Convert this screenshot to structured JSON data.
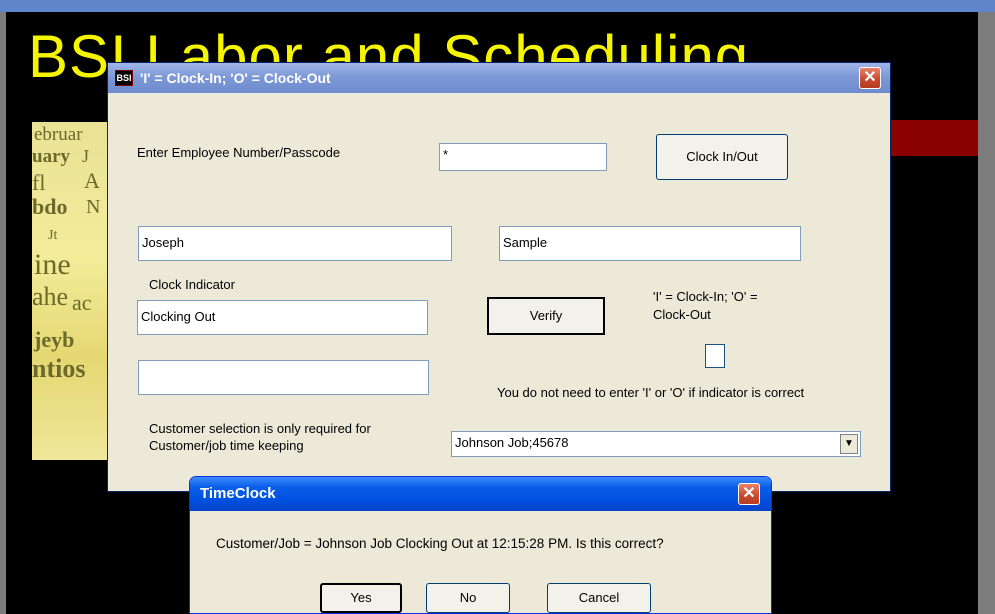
{
  "background": {
    "title": "BSI Labor and Scheduling",
    "calendar_text": [
      "ebruar",
      "uary",
      "J",
      "fl",
      "A",
      "bdo",
      "N",
      "Jt",
      "ine",
      "ahe",
      "ac",
      "jeyb",
      "ntios"
    ]
  },
  "main_dialog": {
    "icon_text": "BSI",
    "title": "'I' = Clock-In; 'O' = Clock-Out",
    "close_glyph": "✕",
    "employee_label": "Enter Employee Number/Passcode",
    "employee_value": "*",
    "clock_button": "Clock In/Out",
    "first_name": "Joseph",
    "last_name": "Sample",
    "indicator_label": "Clock Indicator",
    "indicator_value": "Clocking Out",
    "verify_button": "Verify",
    "legend_line1": "'I' = Clock-In; 'O' =",
    "legend_line2": "Clock-Out",
    "override_value": "",
    "hint_text": "You do not need to enter 'I' or 'O' if indicator is correct",
    "customer_label_line1": "Customer selection is only required for",
    "customer_label_line2": "Customer/job time keeping",
    "customer_selected": "Johnson Job;45678",
    "combo_arrow": "▼"
  },
  "timeclock_dialog": {
    "title": "TimeClock",
    "close_glyph": "✕",
    "message": "Customer/Job = Johnson Job Clocking Out at 12:15:28 PM.  Is this correct?",
    "yes_button": "Yes",
    "no_button": "No",
    "cancel_button": "Cancel"
  },
  "colors": {
    "title_yellow": "#f5f500",
    "dialog_face": "#ece9d8",
    "xp_blue": "#0050e0",
    "close_red": "#c94b2f"
  }
}
